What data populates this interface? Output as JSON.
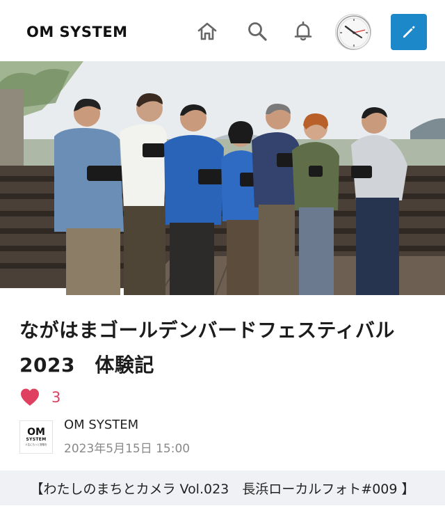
{
  "header": {
    "logo_text": "OM SYSTEM",
    "icons": [
      "home-icon",
      "search-icon",
      "bell-icon",
      "avatar-clock",
      "pencil-icon"
    ],
    "accent_color": "#1c88c9"
  },
  "article": {
    "title_line1": "ながはまゴールデンバードフェスティバル",
    "title_line2": "2023　体験記",
    "like_count": "3",
    "like_color": "#e0405f",
    "author": {
      "name": "OM SYSTEM",
      "logo_om": "OM",
      "logo_system": "SYSTEM",
      "logo_tagline": "人生にもっと冒険を",
      "date": "2023年5月15日 15:00"
    },
    "series_banner": "【わたしのまちとカメラ Vol.023　長浜ローカルフォト#009 】"
  }
}
